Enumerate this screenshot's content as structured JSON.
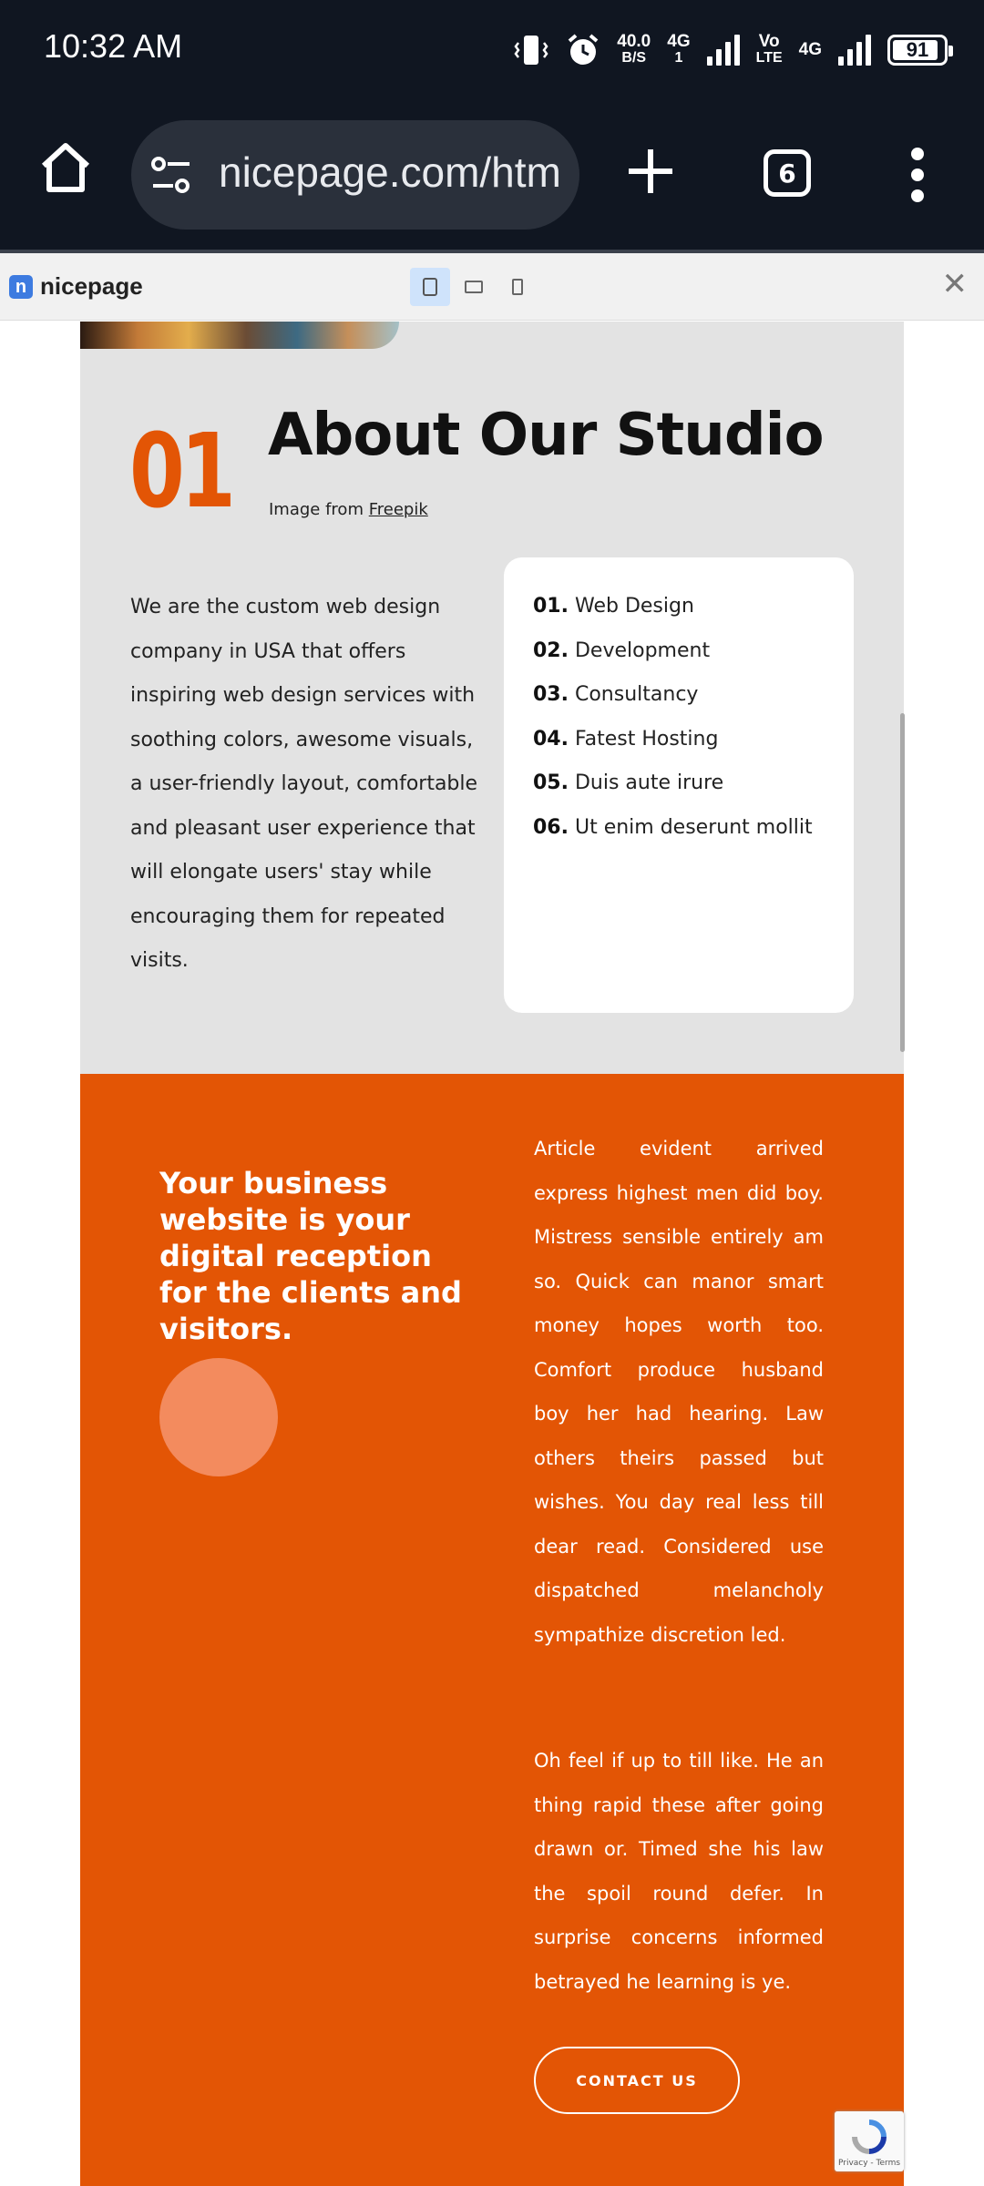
{
  "status_bar": {
    "time": "10:32 AM",
    "net_speed_value": "40.0",
    "net_speed_unit": "B/S",
    "net1_type": "4G",
    "net1_sub": "1",
    "volte_top": "Vo",
    "volte_bottom": "LTE",
    "net2_type": "4G",
    "battery": "91",
    "battery_level": 0.91
  },
  "browser": {
    "url": "nicepage.com/htm",
    "tab_count": "6"
  },
  "preview_bar": {
    "logo_letter": "n",
    "brand": "nicepage",
    "close": "✕"
  },
  "about": {
    "number": "01",
    "title": "About Our Studio",
    "image_credit_prefix": "Image from ",
    "image_credit_link": "Freepik",
    "body": "We are the custom web design company in USA that offers inspiring web design services with soothing colors, awesome visuals, a user-friendly layout, comfortable and pleasant user experience that will elongate users' stay while encouraging them for repeated visits.",
    "services": [
      {
        "num": "01.",
        "label": "Web Design"
      },
      {
        "num": "02.",
        "label": "Development"
      },
      {
        "num": "03.",
        "label": "Consultancy"
      },
      {
        "num": "04.",
        "label": "Fatest Hosting"
      },
      {
        "num": "05.",
        "label": "Duis aute irure"
      },
      {
        "num": "06.",
        "label": "Ut enim deserunt mollit"
      }
    ]
  },
  "business": {
    "title": "Your business website is your digital reception for the clients and visitors.",
    "paragraph1": "Article evident arrived express highest men did boy. Mistress sensible entirely am so. Quick can manor smart money hopes worth too. Comfort produce husband boy her had hearing. Law others theirs passed but wishes. You day real less till dear read. Considered use dispatched melancholy sympathize discretion led.",
    "paragraph2": "Oh feel if up to till like. He an thing rapid these after going drawn or. Timed she his law the spoil round defer. In surprise concerns informed betrayed he learning is ye.",
    "cta": "CONTACT US"
  },
  "recaptcha": {
    "text": "Privacy - Terms"
  },
  "colors": {
    "status_bg": "#101621",
    "accent_orange": "#e35505",
    "about_bg": "#e3e3e3",
    "circle": "#f38b5e",
    "brand_blue": "#3d7be0"
  }
}
